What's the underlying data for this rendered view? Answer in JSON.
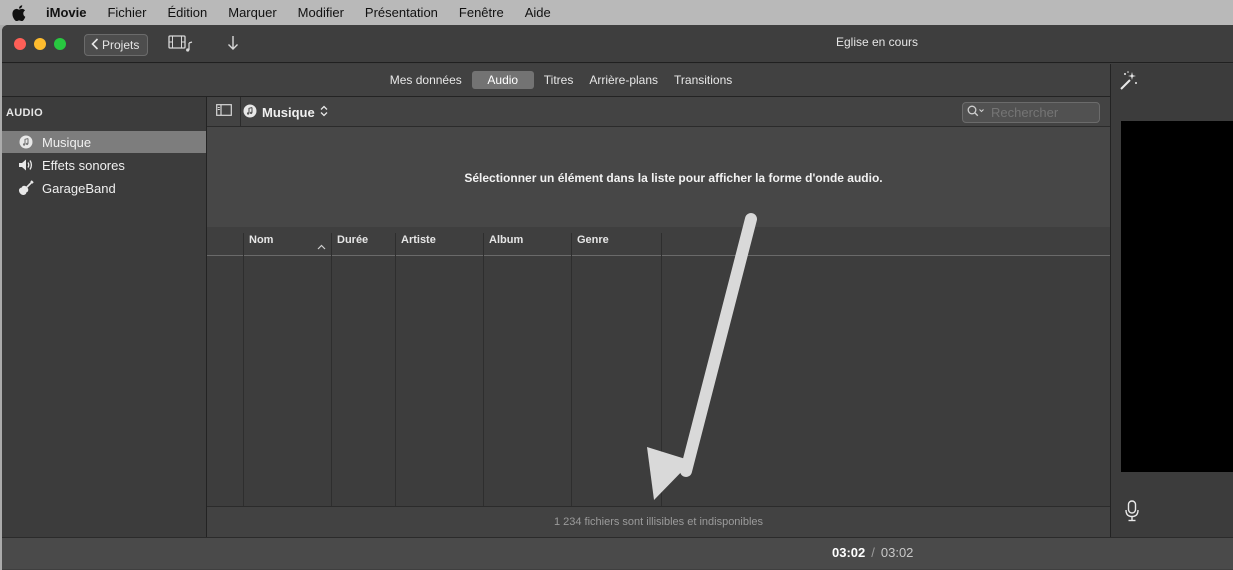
{
  "menubar": {
    "items": [
      "iMovie",
      "Fichier",
      "Édition",
      "Marquer",
      "Modifier",
      "Présentation",
      "Fenêtre",
      "Aide"
    ]
  },
  "titlebar": {
    "back_label": "Projets",
    "title": "Eglise en cours"
  },
  "tabs": [
    "Mes données",
    "Audio",
    "Titres",
    "Arrière-plans",
    "Transitions"
  ],
  "sidebar": {
    "header": "AUDIO",
    "items": [
      {
        "label": "Musique",
        "icon": "music-note-icon",
        "selected": true
      },
      {
        "label": "Effets sonores",
        "icon": "speaker-icon",
        "selected": false
      },
      {
        "label": "GarageBand",
        "icon": "guitar-icon",
        "selected": false
      }
    ]
  },
  "browser": {
    "source": "Musique",
    "search_placeholder": "Rechercher",
    "waveform_message": "Sélectionner un élément dans la liste pour afficher la forme d'onde audio.",
    "columns": [
      "Nom",
      "Durée",
      "Artiste",
      "Album",
      "Genre"
    ],
    "footer_status": "1 234 fichiers sont illisibles et indisponibles"
  },
  "timecode": {
    "current": "03:02",
    "separator": "/",
    "total": "03:02"
  },
  "colors": {
    "selection": "#7d7d7d",
    "window_bg": "#3f3f3f",
    "annotation_arrow": "#d9d9d9"
  }
}
